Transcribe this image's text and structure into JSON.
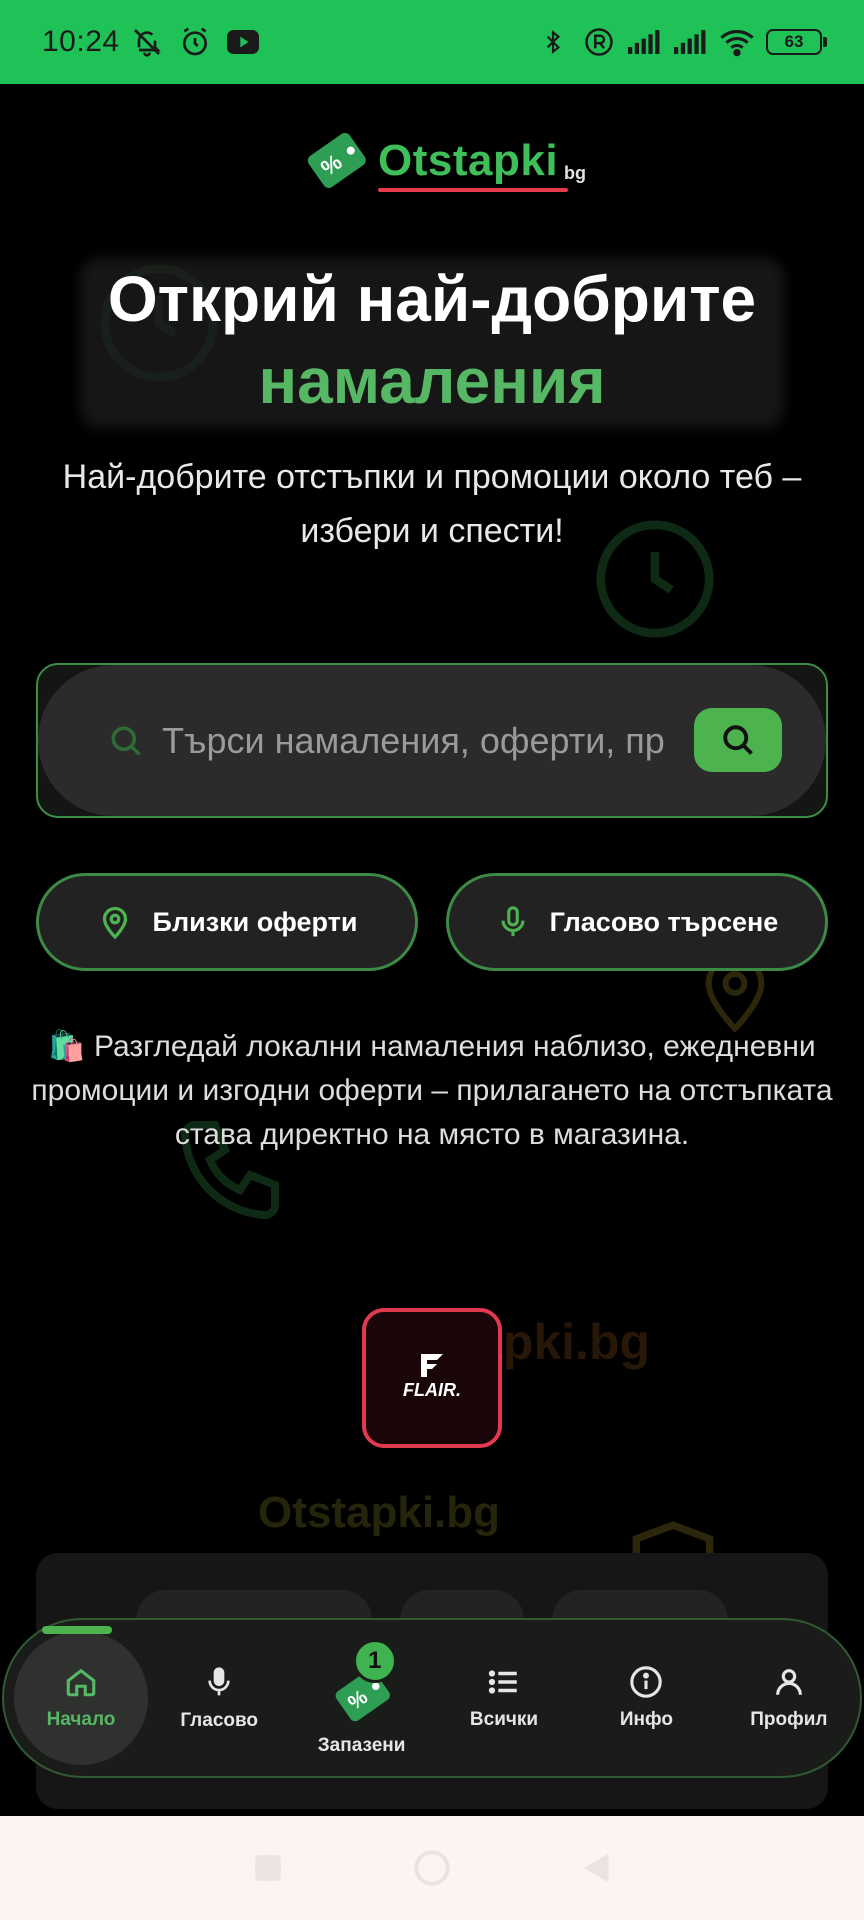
{
  "status_bar": {
    "time": "10:24",
    "battery": "63",
    "icons": [
      "mute-icon",
      "alarm-icon",
      "youtube-icon",
      "bluetooth-icon",
      "registered-icon",
      "signal-icon",
      "signal-icon",
      "wifi-icon",
      "battery-icon"
    ]
  },
  "logo": {
    "text": "Otstapki",
    "suffix": "bg",
    "tag_symbol": "%"
  },
  "hero": {
    "title_line1": "Открий най-добрите",
    "title_line2": "намаления",
    "subtitle": "Най-добрите отстъпки и промоции около теб – избери и спести!"
  },
  "search": {
    "placeholder": "Търси намаления, оферти, пр"
  },
  "actions": {
    "nearby_label": "Близки оферти",
    "voice_label": "Гласово търсене"
  },
  "info": {
    "emoji": "🛍️",
    "text": "Разгледай локални намаления наблизо, ежедневни промоции и изгодни оферти – прилагането на отстъпката става директно на място в магазина."
  },
  "brand": {
    "name": "FLAIR."
  },
  "background": {
    "watermark1": "Otstapki.bg",
    "watermark2": "Otstapki.bg"
  },
  "bottom_nav": {
    "items": [
      {
        "label": "Начало",
        "icon": "home-icon",
        "active": true
      },
      {
        "label": "Гласово",
        "icon": "mic-icon"
      },
      {
        "label": "Запазени",
        "icon": "tag-icon",
        "badge": "1"
      },
      {
        "label": "Всички",
        "icon": "list-icon"
      },
      {
        "label": "Инфо",
        "icon": "info-icon"
      },
      {
        "label": "Профил",
        "icon": "user-icon"
      }
    ]
  },
  "colors": {
    "status_bar": "#1fc257",
    "accent_green": "#56b765",
    "brand_red": "#e03a4e",
    "background": "#000000"
  }
}
